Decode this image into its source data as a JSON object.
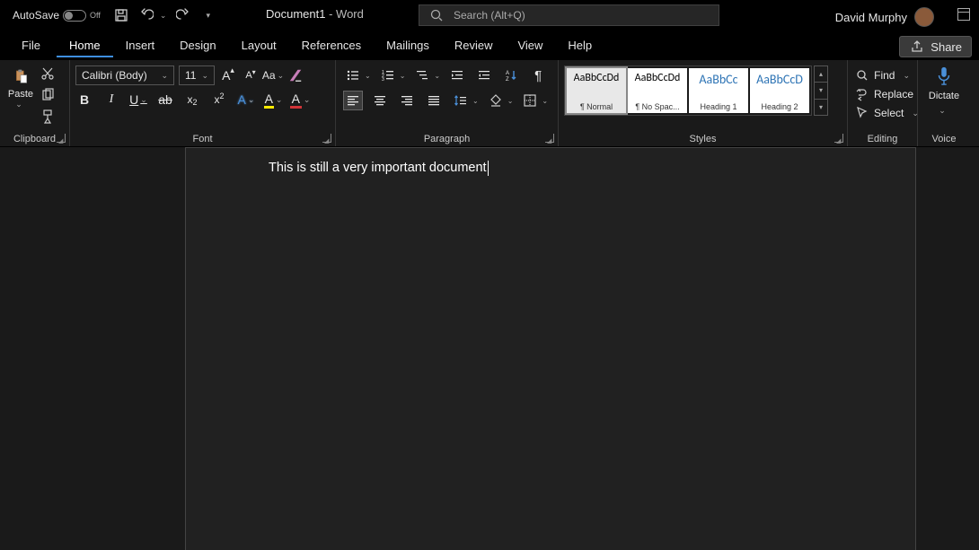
{
  "titlebar": {
    "autosave_label": "AutoSave",
    "autosave_state": "Off",
    "doc_name": "Document1",
    "app_suffix": "  -  Word",
    "search_placeholder": "Search (Alt+Q)",
    "user_name": "David Murphy"
  },
  "tabs": {
    "file": "File",
    "home": "Home",
    "insert": "Insert",
    "design": "Design",
    "layout": "Layout",
    "references": "References",
    "mailings": "Mailings",
    "review": "Review",
    "view": "View",
    "help": "Help",
    "share": "Share"
  },
  "ribbon": {
    "clipboard": {
      "paste": "Paste",
      "label": "Clipboard"
    },
    "font": {
      "name": "Calibri (Body)",
      "size": "11",
      "label": "Font"
    },
    "paragraph": {
      "label": "Paragraph"
    },
    "styles": {
      "label": "Styles",
      "items": [
        {
          "preview": "AaBbCcDd",
          "name": "¶ Normal",
          "heading": false
        },
        {
          "preview": "AaBbCcDd",
          "name": "¶ No Spac...",
          "heading": false
        },
        {
          "preview": "AaBbCc",
          "name": "Heading 1",
          "heading": true
        },
        {
          "preview": "AaBbCcD",
          "name": "Heading 2",
          "heading": true
        }
      ]
    },
    "editing": {
      "find": "Find",
      "replace": "Replace",
      "select": "Select",
      "label": "Editing"
    },
    "voice": {
      "dictate": "Dictate",
      "label": "Voice"
    }
  },
  "document": {
    "body": "This is still a very important document"
  }
}
